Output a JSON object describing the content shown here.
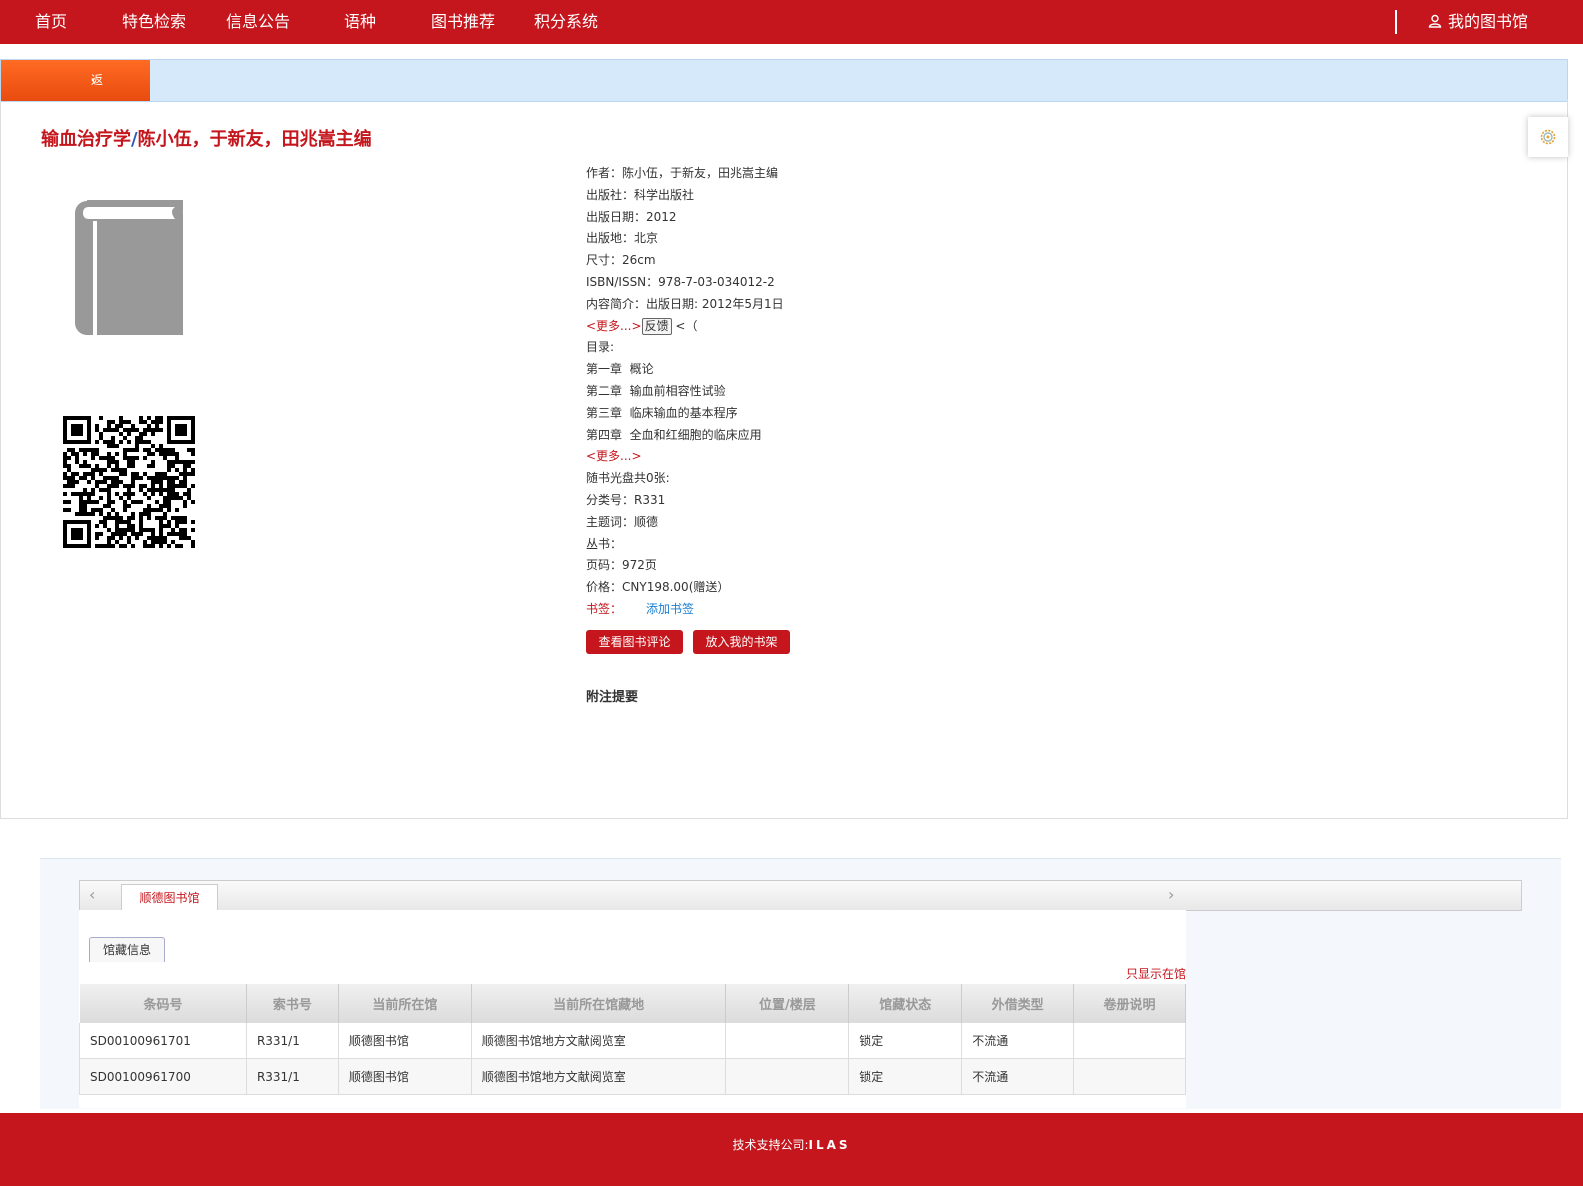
{
  "nav": {
    "items": [
      {
        "label": "首页"
      },
      {
        "label": "特色检索"
      },
      {
        "label": "信息公告"
      },
      {
        "label": "语种"
      },
      {
        "label": "图书推荐"
      },
      {
        "label": "积分系统"
      }
    ],
    "my_library": "我的图书馆"
  },
  "back_button": "返回列表",
  "book": {
    "title": "输血治疗学",
    "title_slash": "/",
    "responsibility": "陈小伍，于新友，田兆嵩主编",
    "fields": [
      {
        "label": "作者：",
        "value": "陈小伍，于新友，田兆嵩主编"
      },
      {
        "label": "出版社：",
        "value": "科学出版社"
      },
      {
        "label": "出版日期：",
        "value": "2012"
      },
      {
        "label": "出版地：",
        "value": "北京"
      },
      {
        "label": "尺寸：",
        "value": "26cm"
      },
      {
        "label": "ISBN/ISSN：",
        "value": "978-7-03-034012-2"
      },
      {
        "label": "内容简介：",
        "value": "出版日期: 2012年5月1日"
      }
    ],
    "more_link": "<更多...>",
    "feedback_button": "反馈",
    "after_feedback": "<（",
    "toc_label": "目录:",
    "toc": [
      "第一章  概论",
      "第二章  输血前相容性试验",
      "第三章  临床输血的基本程序",
      "第四章  全血和红细胞的临床应用"
    ],
    "toc_more": "<更多...>",
    "fields2": [
      {
        "label": "随书光盘共0张:",
        "value": ""
      },
      {
        "label": "分类号：",
        "value": "R331"
      },
      {
        "label": "主题词：",
        "value": "顺德"
      },
      {
        "label": "丛书：",
        "value": ""
      },
      {
        "label": "页码：",
        "value": "972页"
      },
      {
        "label": "价格：",
        "value": "CNY198.00(赠送）"
      }
    ],
    "bookmark_label": "书签：",
    "add_bookmark": "添加书签",
    "view_reviews": "查看图书评论",
    "add_to_shelf": "放入我的书架",
    "notes_heading": "附注提要"
  },
  "holdings": {
    "library_tab": "顺德图书馆",
    "info_tab": "馆藏信息",
    "only_in_library": "只显示在馆",
    "columns": [
      "条码号",
      "索书号",
      "当前所在馆",
      "当前所在馆藏地",
      "位置/楼层",
      "馆藏状态",
      "外借类型",
      "卷册说明"
    ],
    "rows": [
      [
        "SD00100961701",
        "R331/1",
        "顺德图书馆",
        "顺德图书馆地方文献阅览室",
        "",
        "锁定",
        "不流通",
        ""
      ],
      [
        "SD00100961700",
        "R331/1",
        "顺德图书馆",
        "顺德图书馆地方文献阅览室",
        "",
        "锁定",
        "不流通",
        ""
      ]
    ]
  },
  "footer": {
    "label": "技术支持公司:",
    "company": "ILAS"
  },
  "colors": {
    "brand_red": "#c4161c",
    "back_orange": "#f05a1a",
    "subbar_blue": "#d5e9fb",
    "link_blue": "#1a7fd1"
  },
  "icons": [
    "user-icon",
    "chevron-left-icon",
    "book-placeholder-icon",
    "qr-code-icon",
    "gear-icon",
    "arrow-left-icon",
    "arrow-right-icon"
  ]
}
